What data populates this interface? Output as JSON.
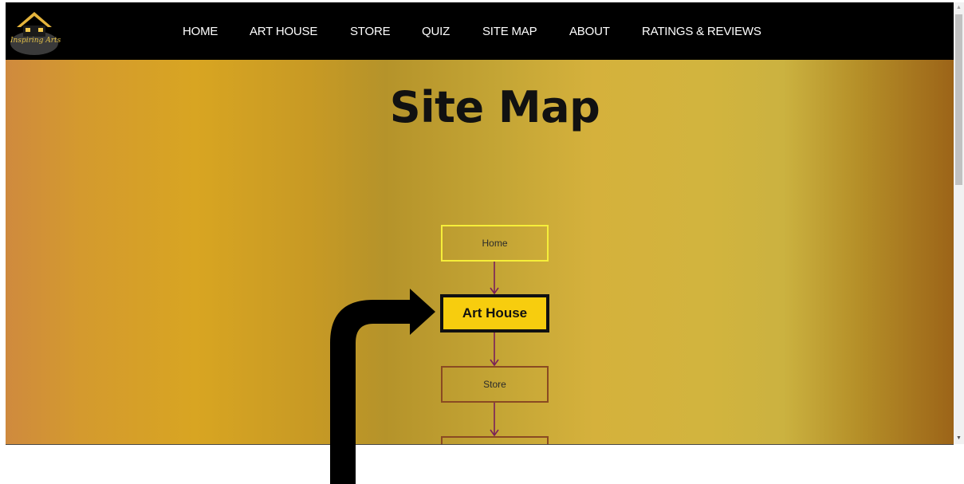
{
  "logo": {
    "text": "Inspiring Arts"
  },
  "nav": {
    "items": [
      {
        "label": "HOME"
      },
      {
        "label": "ART HOUSE"
      },
      {
        "label": "STORE"
      },
      {
        "label": "QUIZ"
      },
      {
        "label": "SITE MAP"
      },
      {
        "label": "ABOUT"
      },
      {
        "label": "RATINGS & REVIEWS"
      }
    ]
  },
  "hero": {
    "title": "Site Map"
  },
  "sitemap": {
    "nodes": [
      {
        "label": "Home"
      },
      {
        "label": "Art House",
        "highlighted": true
      },
      {
        "label": "Store"
      },
      {
        "label": ""
      }
    ]
  },
  "colors": {
    "nav_bg": "#000000",
    "highlight_fill": "#f7cd0e",
    "home_border": "#f6ee3a",
    "node_border": "#8a4a22",
    "connector": "#7a1f5a",
    "annotation_arrow": "#000000"
  },
  "icons": {
    "logo": "house-logo-icon",
    "scroll_up": "scroll-up-arrow-icon",
    "scroll_down": "scroll-down-arrow-icon",
    "annotation": "pointer-arrow-icon"
  }
}
